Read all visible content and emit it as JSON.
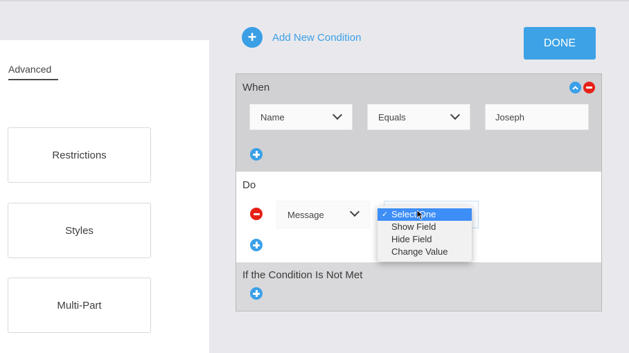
{
  "left_panel": {
    "active_tab": "Advanced",
    "cards": [
      {
        "label": "Restrictions"
      },
      {
        "label": "Styles"
      },
      {
        "label": "Multi-Part"
      }
    ]
  },
  "toolbar": {
    "add_condition_label": "Add New Condition",
    "add_condition_icon": "+",
    "done_label": "DONE"
  },
  "colors": {
    "accent_blue": "#3b9fe5",
    "delete_red": "#e62117",
    "selected_option": "#3d8ef7"
  },
  "condition": {
    "when": {
      "title": "When",
      "field": "Name",
      "operator": "Equals",
      "value": "Joseph"
    },
    "do": {
      "title": "Do",
      "action_type": "Message",
      "dropdown": {
        "selected": "Select One",
        "check": "✓",
        "options": [
          "Select One",
          "Show Field",
          "Hide Field",
          "Change Value"
        ]
      }
    },
    "not_met": {
      "title": "If the Condition Is Not Met"
    }
  }
}
